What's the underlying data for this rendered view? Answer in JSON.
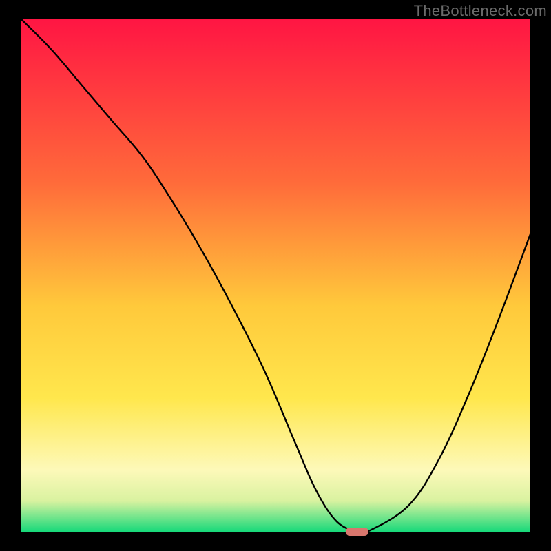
{
  "chart_data": {
    "type": "line",
    "title": "",
    "xlabel": "",
    "ylabel": "",
    "watermark": "TheBottleneck.com",
    "xlim": [
      0,
      100
    ],
    "ylim": [
      0,
      100
    ],
    "curve": {
      "x": [
        0,
        6,
        12,
        18,
        24,
        30,
        36,
        42,
        48,
        54,
        58,
        62,
        66,
        68,
        76,
        82,
        88,
        94,
        100
      ],
      "y": [
        100,
        94,
        87,
        80,
        73,
        64,
        54,
        43,
        31,
        17,
        8,
        2,
        0,
        0,
        5,
        14,
        27,
        42,
        58
      ]
    },
    "marker": {
      "x": 66,
      "y": 0,
      "width": 4.5,
      "height": 1.6
    }
  },
  "colors": {
    "background_frame": "#000000",
    "gradient_top": "#ff1543",
    "gradient_mid1": "#ff6b3a",
    "gradient_mid2": "#ffc93b",
    "gradient_mid3": "#ffe74d",
    "gradient_low1": "#fdf9b9",
    "gradient_low2": "#d9f2a0",
    "gradient_bottom": "#17d97a",
    "curve": "#000000",
    "marker": "#d8766d",
    "watermark": "#6b6b6b"
  },
  "watermark_text": "TheBottleneck.com"
}
